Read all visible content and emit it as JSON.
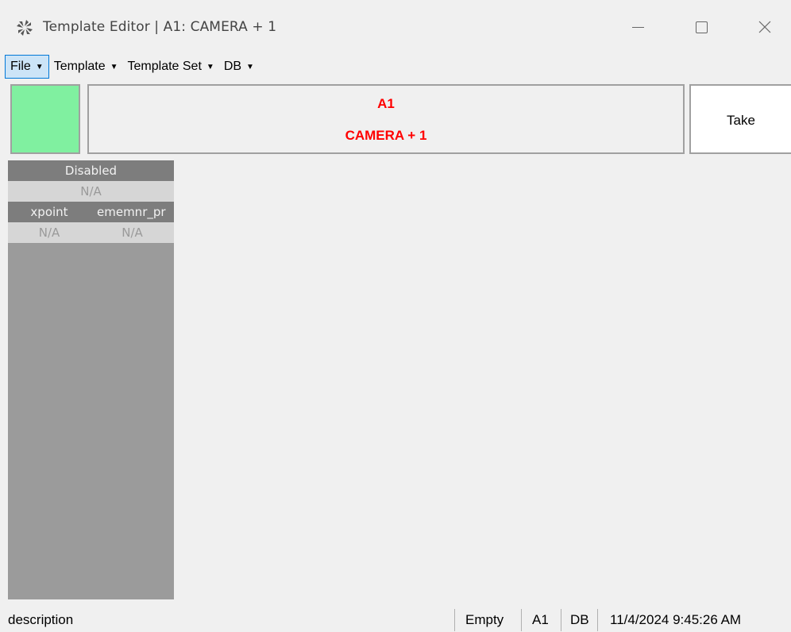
{
  "window": {
    "title": "Template Editor | A1: CAMERA + 1",
    "icon": "pinwheel-icon"
  },
  "menu": {
    "items": [
      {
        "label": "File",
        "active": true
      },
      {
        "label": "Template"
      },
      {
        "label": "Template Set"
      },
      {
        "label": "DB"
      }
    ]
  },
  "header": {
    "status_color": "#80f0a0",
    "line1": "A1",
    "line2": "CAMERA + 1",
    "text_color": "#ff0000",
    "take_label": "Take"
  },
  "panel": {
    "header1": "Disabled",
    "value1": "N/A",
    "col1_header": "xpoint",
    "col2_header": "ememnr_pr",
    "col1_value": "N/A",
    "col2_value": "N/A"
  },
  "statusbar": {
    "description": "description",
    "state": "Empty",
    "id": "A1",
    "db": "DB",
    "timestamp": "11/4/2024 9:45:26 AM"
  }
}
